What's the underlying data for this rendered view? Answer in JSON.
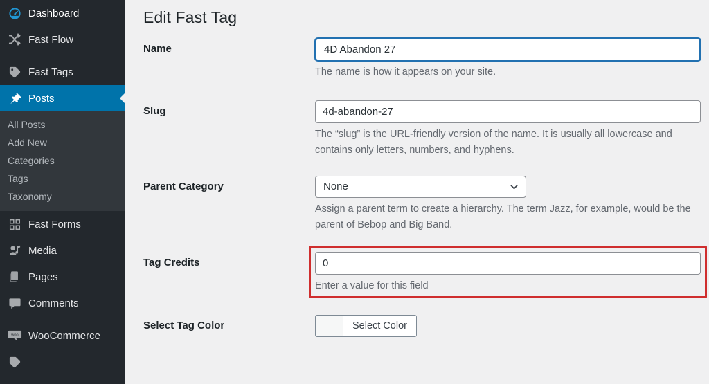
{
  "sidebar": {
    "items": [
      {
        "label": "Dashboard",
        "icon": "dashboard-icon",
        "state": "highlighted"
      },
      {
        "label": "Fast Flow",
        "icon": "shuffle-icon",
        "state": "normal"
      },
      {
        "label": "Fast Tags",
        "icon": "tag-icon",
        "state": "normal"
      },
      {
        "label": "Posts",
        "icon": "pin-icon",
        "state": "active"
      }
    ],
    "submenu": [
      {
        "label": "All Posts"
      },
      {
        "label": "Add New"
      },
      {
        "label": "Categories"
      },
      {
        "label": "Tags"
      },
      {
        "label": "Taxonomy"
      }
    ],
    "items_lower": [
      {
        "label": "Fast Forms",
        "icon": "grid-icon"
      },
      {
        "label": "Media",
        "icon": "media-icon"
      },
      {
        "label": "Pages",
        "icon": "pages-icon"
      },
      {
        "label": "Comments",
        "icon": "comment-icon"
      },
      {
        "label": "WooCommerce",
        "icon": "woocommerce-icon"
      }
    ],
    "colors": {
      "background": "#23282d",
      "submenu_background": "#32373c",
      "active_background": "#0073aa",
      "dashboard_icon": "#2196d3",
      "text": "#e3e4e6",
      "submenu_text": "#b4b9be"
    }
  },
  "main": {
    "page_title": "Edit Fast Tag",
    "fields": {
      "name": {
        "label": "Name",
        "value": "4D Abandon 27",
        "help": "The name is how it appears on your site.",
        "focused": true
      },
      "slug": {
        "label": "Slug",
        "value": "4d-abandon-27",
        "help": "The “slug” is the URL-friendly version of the name. It is usually all lowercase and contains only letters, numbers, and hyphens."
      },
      "parent_category": {
        "label": "Parent Category",
        "value": "None",
        "options": [
          "None"
        ],
        "help": "Assign a parent term to create a hierarchy. The term Jazz, for example, would be the parent of Bebop and Big Band."
      },
      "tag_credits": {
        "label": "Tag Credits",
        "value": "0",
        "help": "Enter a value for this field",
        "highlighted": true,
        "highlight_color": "#cf2e2e"
      },
      "select_tag_color": {
        "label": "Select Tag Color",
        "button_label": "Select Color",
        "swatch_color": "#f6f7f7"
      }
    }
  }
}
